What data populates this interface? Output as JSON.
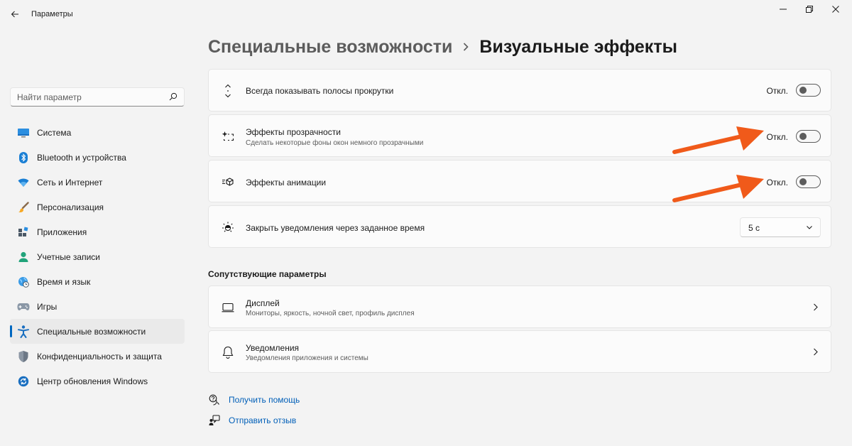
{
  "window": {
    "title": "Параметры"
  },
  "search": {
    "placeholder": "Найти параметр"
  },
  "sidebar": {
    "items": [
      {
        "label": "Система",
        "icon": "system-icon"
      },
      {
        "label": "Bluetooth и устройства",
        "icon": "bluetooth-icon"
      },
      {
        "label": "Сеть и Интернет",
        "icon": "wifi-icon"
      },
      {
        "label": "Персонализация",
        "icon": "brush-icon"
      },
      {
        "label": "Приложения",
        "icon": "apps-icon"
      },
      {
        "label": "Учетные записи",
        "icon": "account-icon"
      },
      {
        "label": "Время и язык",
        "icon": "globe-clock-icon"
      },
      {
        "label": "Игры",
        "icon": "gamepad-icon"
      },
      {
        "label": "Специальные возможности",
        "icon": "accessibility-icon",
        "active": true
      },
      {
        "label": "Конфиденциальность и защита",
        "icon": "shield-icon"
      },
      {
        "label": "Центр обновления Windows",
        "icon": "update-icon"
      }
    ]
  },
  "breadcrumb": {
    "parent": "Специальные возможности",
    "current": "Визуальные эффекты"
  },
  "settings": {
    "scrollbars": {
      "title": "Всегда показывать полосы прокрутки",
      "state": "Откл.",
      "on": false
    },
    "transparency": {
      "title": "Эффекты прозрачности",
      "subtitle": "Сделать некоторые фоны окон немного прозрачными",
      "state": "Откл.",
      "on": false
    },
    "animation": {
      "title": "Эффекты анимации",
      "state": "Откл.",
      "on": false
    },
    "notifications": {
      "title": "Закрыть уведомления через заданное время",
      "value": "5 с"
    }
  },
  "related": {
    "heading": "Сопутствующие параметры",
    "display": {
      "title": "Дисплей",
      "subtitle": "Мониторы, яркость, ночной свет, профиль дисплея"
    },
    "notifications": {
      "title": "Уведомления",
      "subtitle": "Уведомления приложения и системы"
    }
  },
  "help": {
    "get_help": "Получить помощь",
    "feedback": "Отправить отзыв"
  },
  "colors": {
    "accent": "#0067c0",
    "link": "#005fb8",
    "annotation_arrow": "#f05a1a"
  }
}
